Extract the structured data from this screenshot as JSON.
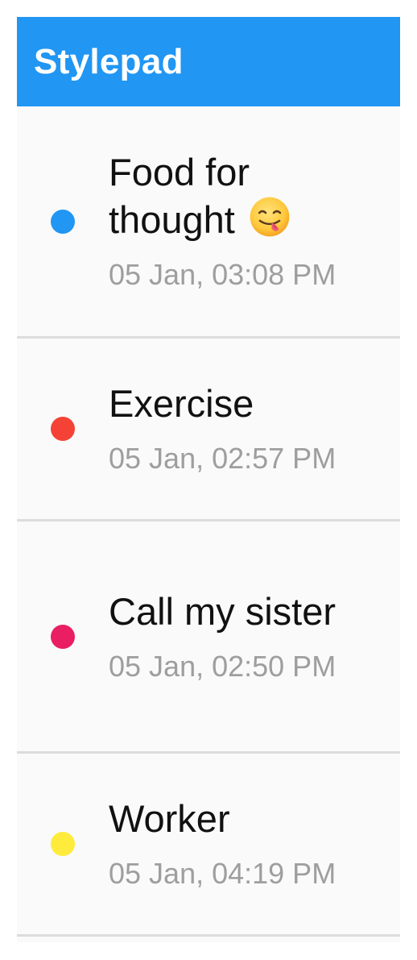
{
  "app_bar": {
    "title": "Stylepad",
    "color": "#2196f3"
  },
  "notes": [
    {
      "title": "Food for thought",
      "emoji": "😋",
      "emoji_icon": "face-savoring-food-icon",
      "date": "05 Jan, 03:08 PM",
      "color": "#2196f3"
    },
    {
      "title": "Exercise",
      "date": "05 Jan, 02:57 PM",
      "color": "#f44336"
    },
    {
      "title": "Call my sister",
      "date": "05 Jan, 02:50 PM",
      "color": "#e91e63"
    },
    {
      "title": "Worker",
      "date": "05 Jan, 04:19 PM",
      "color": "#ffeb3b"
    }
  ]
}
